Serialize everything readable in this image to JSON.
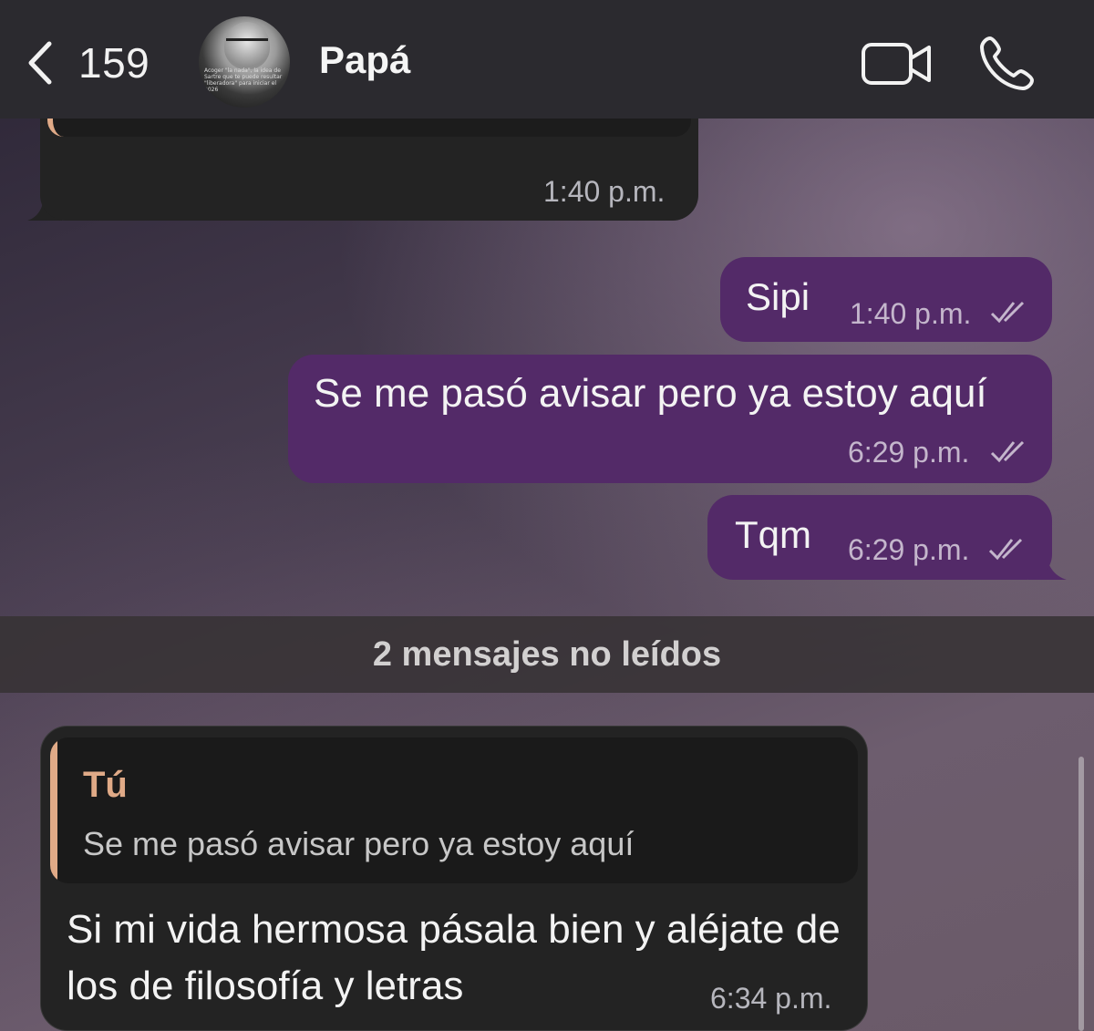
{
  "header": {
    "back_count": "159",
    "contact_name": "Papá",
    "avatar_caption": "Acoger \"la nada\", la idea de Sartre que te puede resultar \"liberadora\" para iniciar el 2026",
    "icons": {
      "back": "chevron-left-icon",
      "video": "video-camera-icon",
      "call": "phone-icon"
    }
  },
  "messages": [
    {
      "direction": "incoming",
      "text": "",
      "time": "1:40 p.m."
    },
    {
      "direction": "outgoing",
      "text": "Sipi",
      "time": "1:40 p.m.",
      "status": "read"
    },
    {
      "direction": "outgoing",
      "text": "Se me pasó avisar pero ya estoy aquí",
      "time": "6:29 p.m.",
      "status": "read"
    },
    {
      "direction": "outgoing",
      "text": "Tqm",
      "time": "6:29 p.m.",
      "status": "read"
    }
  ],
  "unread_separator": "2 mensajes no leídos",
  "reply_message": {
    "quote_author": "Tú",
    "quote_text": "Se me pasó avisar pero ya estoy aquí",
    "text": "Si mi vida hermosa pásala bien y aléjate de los de filosofía y letras",
    "time": "6:34 p.m."
  },
  "colors": {
    "header_bg": "#2b2a2f",
    "incoming_bubble": "#232323",
    "outgoing_bubble": "#532a68",
    "quote_accent": "#e0aa87"
  }
}
